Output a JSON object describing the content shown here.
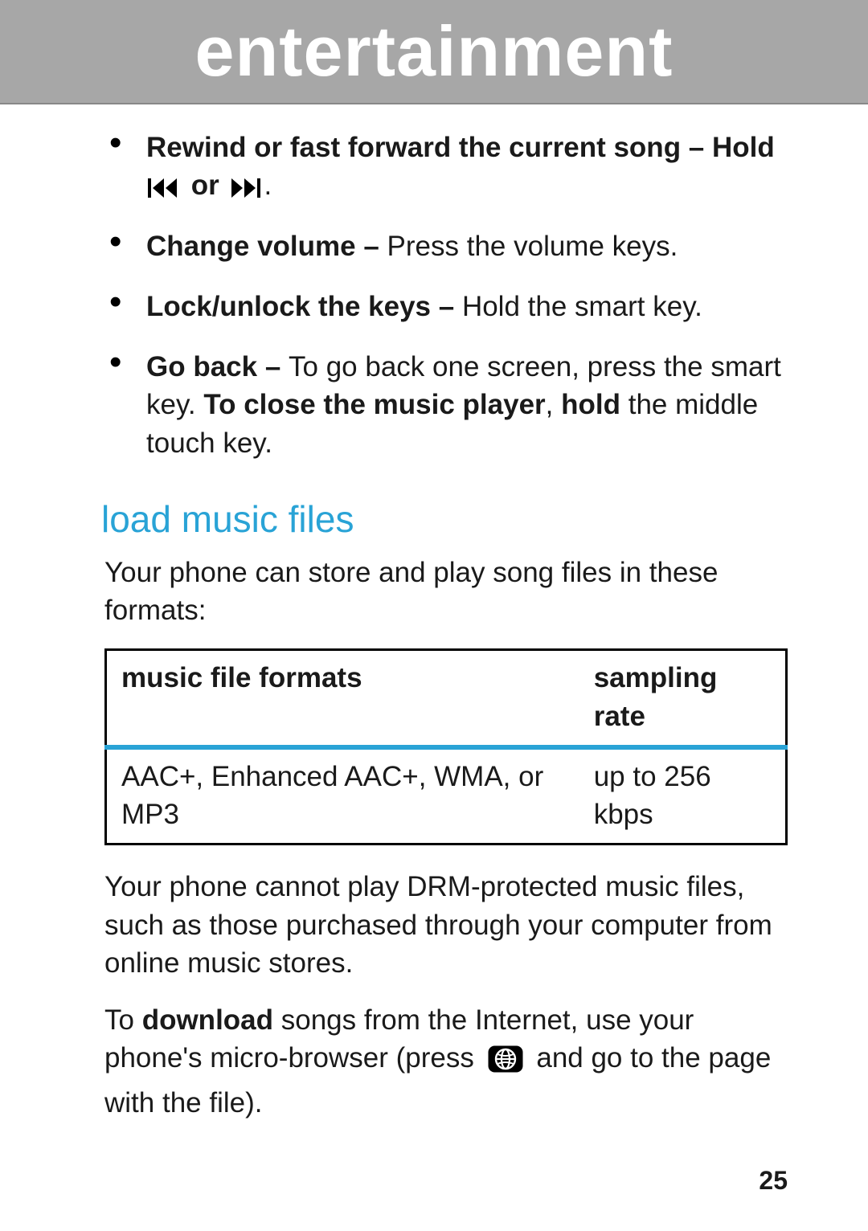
{
  "header": {
    "title": "entertainment"
  },
  "bullets": [
    {
      "lead": "Rewind or fast forward the current song – Hold ",
      "after_first_icon": " or ",
      "trail": "."
    },
    {
      "lead": "Change volume – ",
      "rest": "Press the volume keys."
    },
    {
      "lead": "Lock/unlock the keys – ",
      "rest": "Hold the smart key."
    },
    {
      "lead": "Go back – ",
      "rest1": "To go back one screen, press the smart key. ",
      "bold2": "To close the music player",
      "rest2": ", ",
      "bold3": "hold",
      "rest3": " the middle touch key."
    }
  ],
  "section_heading": "load music files",
  "intro": "Your phone can store and play song files in these formats:",
  "table": {
    "headers": [
      "music file formats",
      "sampling rate"
    ],
    "rows": [
      [
        "AAC+, Enhanced AAC+, WMA, or MP3",
        "up to 256 kbps"
      ]
    ]
  },
  "drm_note": "Your phone cannot play DRM-protected music files, such as those purchased through your computer from online music stores.",
  "download": {
    "pre": "To ",
    "bold": "download",
    "mid": " songs from the Internet, use your phone's micro-browser (press ",
    "post": " and go to the page with the file)."
  },
  "page_number": "25"
}
